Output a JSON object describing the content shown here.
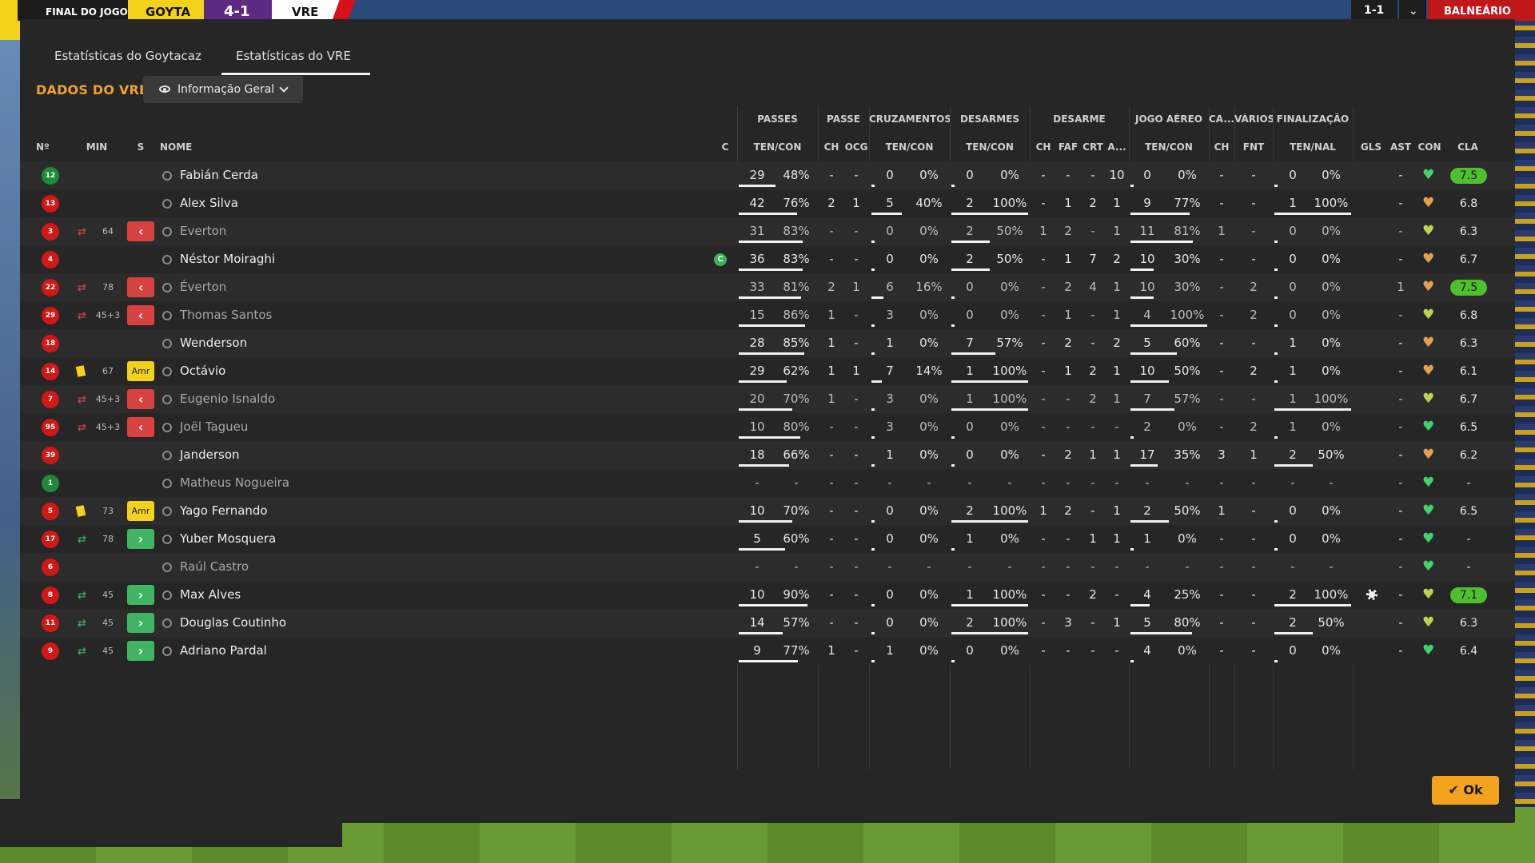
{
  "topbar": {
    "match_state": "FINAL DO JOGO",
    "home_abbr": "GOYTA",
    "score": "4-1",
    "away_abbr": "VRE",
    "mini_score": "1-1",
    "chevron": "⌄",
    "room_button": "BALNEÁRIO",
    "colors": {
      "home": "#f3d21c",
      "score_bg": "#5b2a82",
      "room": "#c01818"
    }
  },
  "tabs": [
    "Estatísticas do Goytacaz",
    "Estatísticas do VRE"
  ],
  "active_tab": 1,
  "section_title": "DADOS DO VRE",
  "view_dropdown": {
    "label": "Informação Geral",
    "icon": "eye-icon"
  },
  "column_groups": [
    "PASSES",
    "PASSE",
    "CRUZAMENTOS",
    "DESARMES",
    "DESARME",
    "JOGO AÉREO",
    "CA...",
    "VÁRIOS",
    "FINALIZAÇÃO"
  ],
  "columns": {
    "num": "Nº",
    "min": "MIN",
    "s": "S",
    "name": "NOME",
    "c": "C",
    "passes": "TEN/CON",
    "passe_ch": "CH",
    "passe_ocg": "OCG",
    "cruz": "TEN/CON",
    "desarmes": "TEN/CON",
    "des_ch": "CH",
    "des_faf": "FAF",
    "des_crt": "CRT",
    "des_a": "A...",
    "aereo": "TEN/CON",
    "ca_ch": "CH",
    "var_fnt": "FNT",
    "fin": "TEN/NAL",
    "gls": "GLS",
    "ast": "AST",
    "con": "CON",
    "cla": "CLA"
  },
  "players": [
    {
      "num": "12",
      "gk": true,
      "min": "",
      "sub": "",
      "card": "",
      "btn": "",
      "name": "Fabián Cerda",
      "dim": false,
      "cap": false,
      "pass_t": "29",
      "pass_p": "48%",
      "pass_pct": 48,
      "p_ch": "-",
      "p_ocg": "-",
      "cz_t": "0",
      "cz_p": "0%",
      "cz_pct": 0,
      "d_t": "0",
      "d_p": "0%",
      "d_pct": 0,
      "d_ch": "-",
      "d_faf": "-",
      "d_crt": "-",
      "d_a": "10",
      "a_t": "0",
      "a_p": "0%",
      "a_pct": 0,
      "ca_ch": "-",
      "fnt": "-",
      "f_t": "0",
      "f_p": "0%",
      "f_pct": 0,
      "gls": "",
      "ast": "-",
      "con": "green",
      "cla": "7.5",
      "cla_hi": true
    },
    {
      "num": "13",
      "gk": false,
      "min": "",
      "sub": "",
      "card": "",
      "btn": "",
      "name": "Alex Silva",
      "dim": false,
      "cap": false,
      "pass_t": "42",
      "pass_p": "76%",
      "pass_pct": 76,
      "p_ch": "2",
      "p_ocg": "1",
      "cz_t": "5",
      "cz_p": "40%",
      "cz_pct": 40,
      "d_t": "2",
      "d_p": "100%",
      "d_pct": 100,
      "d_ch": "-",
      "d_faf": "1",
      "d_crt": "2",
      "d_a": "1",
      "a_t": "9",
      "a_p": "77%",
      "a_pct": 77,
      "ca_ch": "-",
      "fnt": "-",
      "f_t": "1",
      "f_p": "100%",
      "f_pct": 100,
      "gls": "",
      "ast": "-",
      "con": "orange",
      "cla": "6.8",
      "cla_hi": false
    },
    {
      "num": "3",
      "gk": false,
      "min": "64",
      "sub": "out",
      "card": "",
      "btn": "out",
      "name": "Everton",
      "dim": true,
      "cap": false,
      "pass_t": "31",
      "pass_p": "83%",
      "pass_pct": 83,
      "p_ch": "-",
      "p_ocg": "-",
      "cz_t": "0",
      "cz_p": "0%",
      "cz_pct": 0,
      "d_t": "2",
      "d_p": "50%",
      "d_pct": 50,
      "d_ch": "1",
      "d_faf": "2",
      "d_crt": "-",
      "d_a": "1",
      "a_t": "11",
      "a_p": "81%",
      "a_pct": 81,
      "ca_ch": "1",
      "fnt": "-",
      "f_t": "0",
      "f_p": "0%",
      "f_pct": 0,
      "gls": "",
      "ast": "-",
      "con": "yellow",
      "cla": "6.3",
      "cla_hi": false
    },
    {
      "num": "4",
      "gk": false,
      "min": "",
      "sub": "",
      "card": "",
      "btn": "",
      "name": "Néstor Moiraghi",
      "dim": false,
      "cap": true,
      "pass_t": "36",
      "pass_p": "83%",
      "pass_pct": 83,
      "p_ch": "-",
      "p_ocg": "-",
      "cz_t": "0",
      "cz_p": "0%",
      "cz_pct": 0,
      "d_t": "2",
      "d_p": "50%",
      "d_pct": 50,
      "d_ch": "-",
      "d_faf": "1",
      "d_crt": "7",
      "d_a": "2",
      "a_t": "10",
      "a_p": "30%",
      "a_pct": 30,
      "ca_ch": "-",
      "fnt": "-",
      "f_t": "0",
      "f_p": "0%",
      "f_pct": 0,
      "gls": "",
      "ast": "-",
      "con": "orange",
      "cla": "6.7",
      "cla_hi": false
    },
    {
      "num": "22",
      "gk": false,
      "min": "78",
      "sub": "out",
      "card": "",
      "btn": "out",
      "name": "Éverton",
      "dim": true,
      "cap": false,
      "pass_t": "33",
      "pass_p": "81%",
      "pass_pct": 81,
      "p_ch": "2",
      "p_ocg": "1",
      "cz_t": "6",
      "cz_p": "16%",
      "cz_pct": 16,
      "d_t": "0",
      "d_p": "0%",
      "d_pct": 0,
      "d_ch": "-",
      "d_faf": "2",
      "d_crt": "4",
      "d_a": "1",
      "a_t": "10",
      "a_p": "30%",
      "a_pct": 30,
      "ca_ch": "-",
      "fnt": "2",
      "f_t": "0",
      "f_p": "0%",
      "f_pct": 0,
      "gls": "",
      "ast": "1",
      "con": "orange",
      "cla": "7.5",
      "cla_hi": true
    },
    {
      "num": "29",
      "gk": false,
      "min": "45+3",
      "sub": "out",
      "card": "",
      "btn": "out",
      "name": "Thomas Santos",
      "dim": true,
      "cap": false,
      "pass_t": "15",
      "pass_p": "86%",
      "pass_pct": 86,
      "p_ch": "1",
      "p_ocg": "-",
      "cz_t": "3",
      "cz_p": "0%",
      "cz_pct": 0,
      "d_t": "0",
      "d_p": "0%",
      "d_pct": 0,
      "d_ch": "-",
      "d_faf": "1",
      "d_crt": "-",
      "d_a": "1",
      "a_t": "4",
      "a_p": "100%",
      "a_pct": 100,
      "ca_ch": "-",
      "fnt": "2",
      "f_t": "0",
      "f_p": "0%",
      "f_pct": 0,
      "gls": "",
      "ast": "-",
      "con": "yellow",
      "cla": "6.8",
      "cla_hi": false
    },
    {
      "num": "18",
      "gk": false,
      "min": "",
      "sub": "",
      "card": "",
      "btn": "",
      "name": "Wenderson",
      "dim": false,
      "cap": false,
      "pass_t": "28",
      "pass_p": "85%",
      "pass_pct": 85,
      "p_ch": "1",
      "p_ocg": "-",
      "cz_t": "1",
      "cz_p": "0%",
      "cz_pct": 0,
      "d_t": "7",
      "d_p": "57%",
      "d_pct": 57,
      "d_ch": "-",
      "d_faf": "2",
      "d_crt": "-",
      "d_a": "2",
      "a_t": "5",
      "a_p": "60%",
      "a_pct": 60,
      "ca_ch": "-",
      "fnt": "-",
      "f_t": "1",
      "f_p": "0%",
      "f_pct": 0,
      "gls": "",
      "ast": "-",
      "con": "orange",
      "cla": "6.3",
      "cla_hi": false
    },
    {
      "num": "14",
      "gk": false,
      "min": "67",
      "sub": "",
      "card": "yellow",
      "btn": "amr",
      "name": "Octávio",
      "dim": false,
      "cap": false,
      "pass_t": "29",
      "pass_p": "62%",
      "pass_pct": 62,
      "p_ch": "1",
      "p_ocg": "1",
      "cz_t": "7",
      "cz_p": "14%",
      "cz_pct": 14,
      "d_t": "1",
      "d_p": "100%",
      "d_pct": 100,
      "d_ch": "-",
      "d_faf": "1",
      "d_crt": "2",
      "d_a": "1",
      "a_t": "10",
      "a_p": "50%",
      "a_pct": 50,
      "ca_ch": "-",
      "fnt": "2",
      "f_t": "1",
      "f_p": "0%",
      "f_pct": 0,
      "gls": "",
      "ast": "-",
      "con": "orange",
      "cla": "6.1",
      "cla_hi": false
    },
    {
      "num": "7",
      "gk": false,
      "min": "45+3",
      "sub": "out",
      "card": "",
      "btn": "out",
      "name": "Eugenio Isnaldo",
      "dim": true,
      "cap": false,
      "pass_t": "20",
      "pass_p": "70%",
      "pass_pct": 70,
      "p_ch": "1",
      "p_ocg": "-",
      "cz_t": "3",
      "cz_p": "0%",
      "cz_pct": 0,
      "d_t": "1",
      "d_p": "100%",
      "d_pct": 100,
      "d_ch": "-",
      "d_faf": "-",
      "d_crt": "2",
      "d_a": "1",
      "a_t": "7",
      "a_p": "57%",
      "a_pct": 57,
      "ca_ch": "-",
      "fnt": "-",
      "f_t": "1",
      "f_p": "100%",
      "f_pct": 100,
      "gls": "",
      "ast": "-",
      "con": "yellow",
      "cla": "6.7",
      "cla_hi": false
    },
    {
      "num": "95",
      "gk": false,
      "min": "45+3",
      "sub": "out",
      "card": "",
      "btn": "out",
      "name": "Joël Tagueu",
      "dim": true,
      "cap": false,
      "pass_t": "10",
      "pass_p": "80%",
      "pass_pct": 80,
      "p_ch": "-",
      "p_ocg": "-",
      "cz_t": "3",
      "cz_p": "0%",
      "cz_pct": 0,
      "d_t": "0",
      "d_p": "0%",
      "d_pct": 0,
      "d_ch": "-",
      "d_faf": "-",
      "d_crt": "-",
      "d_a": "-",
      "a_t": "2",
      "a_p": "0%",
      "a_pct": 0,
      "ca_ch": "-",
      "fnt": "2",
      "f_t": "1",
      "f_p": "0%",
      "f_pct": 0,
      "gls": "",
      "ast": "-",
      "con": "green",
      "cla": "6.5",
      "cla_hi": false
    },
    {
      "num": "39",
      "gk": false,
      "min": "",
      "sub": "",
      "card": "",
      "btn": "",
      "name": "Janderson",
      "dim": false,
      "cap": false,
      "pass_t": "18",
      "pass_p": "66%",
      "pass_pct": 66,
      "p_ch": "-",
      "p_ocg": "-",
      "cz_t": "1",
      "cz_p": "0%",
      "cz_pct": 0,
      "d_t": "0",
      "d_p": "0%",
      "d_pct": 0,
      "d_ch": "-",
      "d_faf": "2",
      "d_crt": "1",
      "d_a": "1",
      "a_t": "17",
      "a_p": "35%",
      "a_pct": 35,
      "ca_ch": "3",
      "fnt": "1",
      "f_t": "2",
      "f_p": "50%",
      "f_pct": 50,
      "gls": "",
      "ast": "-",
      "con": "orange",
      "cla": "6.2",
      "cla_hi": false
    },
    {
      "num": "1",
      "gk": true,
      "min": "",
      "sub": "",
      "card": "",
      "btn": "",
      "name": "Matheus Nogueira",
      "dim": true,
      "cap": false,
      "pass_t": "-",
      "pass_p": "-",
      "pass_pct": 0,
      "p_ch": "-",
      "p_ocg": "-",
      "cz_t": "-",
      "cz_p": "-",
      "cz_pct": 0,
      "d_t": "-",
      "d_p": "-",
      "d_pct": 0,
      "d_ch": "-",
      "d_faf": "-",
      "d_crt": "-",
      "d_a": "-",
      "a_t": "-",
      "a_p": "-",
      "a_pct": 0,
      "ca_ch": "-",
      "fnt": "-",
      "f_t": "-",
      "f_p": "-",
      "f_pct": 0,
      "gls": "",
      "ast": "-",
      "con": "green",
      "cla": "-",
      "cla_hi": false
    },
    {
      "num": "5",
      "gk": false,
      "min": "73",
      "sub": "",
      "card": "yellow",
      "btn": "amr",
      "name": "Yago Fernando",
      "dim": false,
      "cap": false,
      "pass_t": "10",
      "pass_p": "70%",
      "pass_pct": 70,
      "p_ch": "-",
      "p_ocg": "-",
      "cz_t": "0",
      "cz_p": "0%",
      "cz_pct": 0,
      "d_t": "2",
      "d_p": "100%",
      "d_pct": 100,
      "d_ch": "1",
      "d_faf": "2",
      "d_crt": "-",
      "d_a": "1",
      "a_t": "2",
      "a_p": "50%",
      "a_pct": 50,
      "ca_ch": "1",
      "fnt": "-",
      "f_t": "0",
      "f_p": "0%",
      "f_pct": 0,
      "gls": "",
      "ast": "-",
      "con": "green",
      "cla": "6.5",
      "cla_hi": false
    },
    {
      "num": "17",
      "gk": false,
      "min": "78",
      "sub": "in",
      "card": "",
      "btn": "in",
      "name": "Yuber Mosquera",
      "dim": false,
      "cap": false,
      "pass_t": "5",
      "pass_p": "60%",
      "pass_pct": 60,
      "p_ch": "-",
      "p_ocg": "-",
      "cz_t": "0",
      "cz_p": "0%",
      "cz_pct": 0,
      "d_t": "1",
      "d_p": "0%",
      "d_pct": 0,
      "d_ch": "-",
      "d_faf": "-",
      "d_crt": "1",
      "d_a": "1",
      "a_t": "1",
      "a_p": "0%",
      "a_pct": 0,
      "ca_ch": "-",
      "fnt": "-",
      "f_t": "0",
      "f_p": "0%",
      "f_pct": 0,
      "gls": "",
      "ast": "-",
      "con": "green",
      "cla": "-",
      "cla_hi": false
    },
    {
      "num": "6",
      "gk": false,
      "min": "",
      "sub": "",
      "card": "",
      "btn": "",
      "name": "Raúl Castro",
      "dim": true,
      "cap": false,
      "pass_t": "-",
      "pass_p": "-",
      "pass_pct": 0,
      "p_ch": "-",
      "p_ocg": "-",
      "cz_t": "-",
      "cz_p": "-",
      "cz_pct": 0,
      "d_t": "-",
      "d_p": "-",
      "d_pct": 0,
      "d_ch": "-",
      "d_faf": "-",
      "d_crt": "-",
      "d_a": "-",
      "a_t": "-",
      "a_p": "-",
      "a_pct": 0,
      "ca_ch": "-",
      "fnt": "-",
      "f_t": "-",
      "f_p": "-",
      "f_pct": 0,
      "gls": "",
      "ast": "-",
      "con": "green",
      "cla": "-",
      "cla_hi": false
    },
    {
      "num": "8",
      "gk": false,
      "min": "45",
      "sub": "in",
      "card": "",
      "btn": "in",
      "name": "Max Alves",
      "dim": false,
      "cap": false,
      "pass_t": "10",
      "pass_p": "90%",
      "pass_pct": 90,
      "p_ch": "-",
      "p_ocg": "-",
      "cz_t": "0",
      "cz_p": "0%",
      "cz_pct": 0,
      "d_t": "1",
      "d_p": "100%",
      "d_pct": 100,
      "d_ch": "-",
      "d_faf": "-",
      "d_crt": "2",
      "d_a": "-",
      "a_t": "4",
      "a_p": "25%",
      "a_pct": 25,
      "ca_ch": "-",
      "fnt": "-",
      "f_t": "2",
      "f_p": "100%",
      "f_pct": 100,
      "gls": "ball",
      "ast": "-",
      "con": "yellow",
      "cla": "7.1",
      "cla_hi": true
    },
    {
      "num": "11",
      "gk": false,
      "min": "45",
      "sub": "in",
      "card": "",
      "btn": "in",
      "name": "Douglas Coutinho",
      "dim": false,
      "cap": false,
      "pass_t": "14",
      "pass_p": "57%",
      "pass_pct": 57,
      "p_ch": "-",
      "p_ocg": "-",
      "cz_t": "0",
      "cz_p": "0%",
      "cz_pct": 0,
      "d_t": "2",
      "d_p": "100%",
      "d_pct": 100,
      "d_ch": "-",
      "d_faf": "3",
      "d_crt": "-",
      "d_a": "1",
      "a_t": "5",
      "a_p": "80%",
      "a_pct": 80,
      "ca_ch": "-",
      "fnt": "-",
      "f_t": "2",
      "f_p": "50%",
      "f_pct": 50,
      "gls": "",
      "ast": "-",
      "con": "yellow",
      "cla": "6.3",
      "cla_hi": false
    },
    {
      "num": "9",
      "gk": false,
      "min": "45",
      "sub": "in",
      "card": "",
      "btn": "in",
      "name": "Adriano Pardal",
      "dim": false,
      "cap": false,
      "pass_t": "9",
      "pass_p": "77%",
      "pass_pct": 77,
      "p_ch": "1",
      "p_ocg": "-",
      "cz_t": "1",
      "cz_p": "0%",
      "cz_pct": 0,
      "d_t": "0",
      "d_p": "0%",
      "d_pct": 0,
      "d_ch": "-",
      "d_faf": "-",
      "d_crt": "-",
      "d_a": "-",
      "a_t": "4",
      "a_p": "0%",
      "a_pct": 0,
      "ca_ch": "-",
      "fnt": "-",
      "f_t": "0",
      "f_p": "0%",
      "f_pct": 0,
      "gls": "",
      "ast": "-",
      "con": "green",
      "cla": "6.4",
      "cla_hi": false
    }
  ],
  "buttons": {
    "ok": "Ok",
    "amr_label": "Amr",
    "captain_letter": "C"
  },
  "con_colors": {
    "green": "#3cd66a",
    "orange": "#e3a24a",
    "yellow": "#b9d64a"
  }
}
